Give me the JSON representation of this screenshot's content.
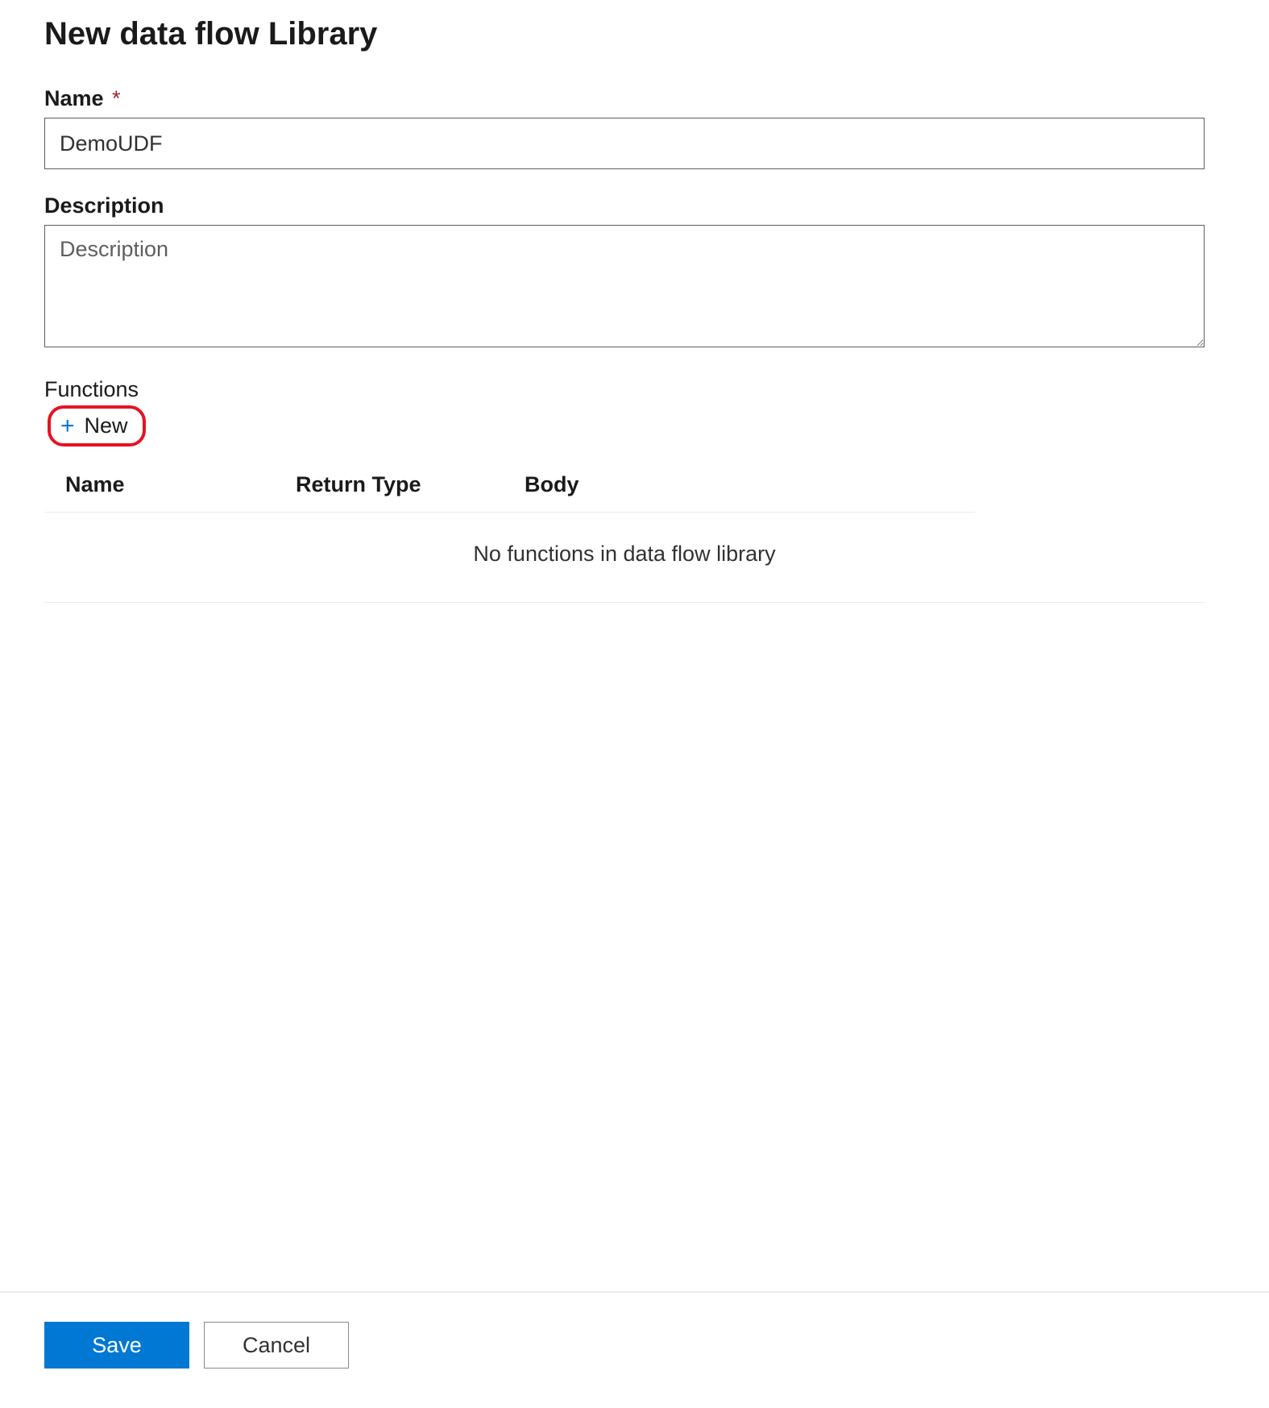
{
  "header": {
    "title": "New data flow Library"
  },
  "form": {
    "name_label": "Name",
    "name_required_star": "*",
    "name_value": "DemoUDF",
    "description_label": "Description",
    "description_placeholder": "Description",
    "description_value": ""
  },
  "functions": {
    "section_label": "Functions",
    "new_button_label": "New",
    "columns": {
      "name": "Name",
      "return_type": "Return Type",
      "body": "Body"
    },
    "empty_message": "No functions in data flow library"
  },
  "footer": {
    "save_label": "Save",
    "cancel_label": "Cancel"
  },
  "colors": {
    "accent": "#0078d4",
    "highlight_border": "#e81123",
    "required": "#a4262c"
  }
}
